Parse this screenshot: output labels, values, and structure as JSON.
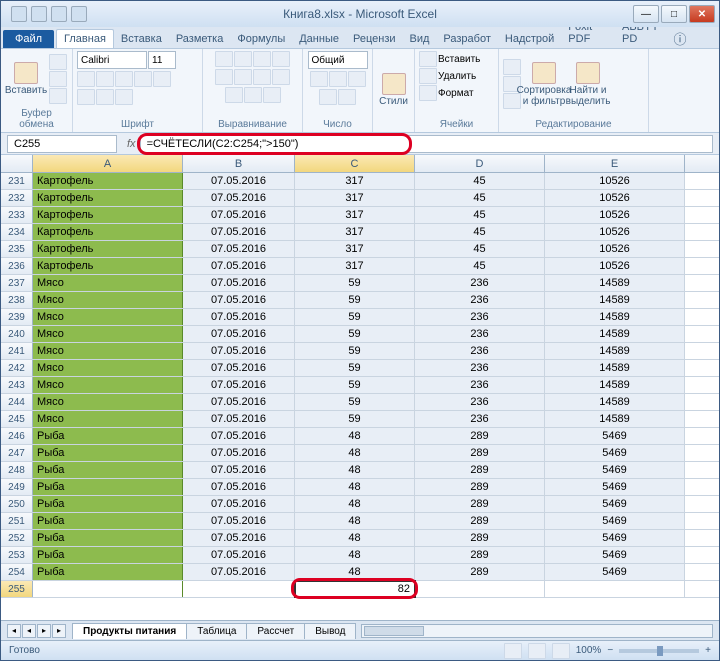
{
  "window": {
    "title": "Книга8.xlsx - Microsoft Excel"
  },
  "ribbon_tabs": {
    "file": "Файл",
    "home": "Главная",
    "insert": "Вставка",
    "layout": "Разметка",
    "formulas": "Формулы",
    "data": "Данные",
    "review": "Рецензи",
    "view": "Вид",
    "developer": "Разработ",
    "addins": "Надстрой",
    "foxit": "Foxit PDF",
    "abbyy": "ABBYY PD"
  },
  "ribbon": {
    "paste": "Вставить",
    "clipboard_label": "Буфер обмена",
    "font_name": "Calibri",
    "font_size": "11",
    "font_label": "Шрифт",
    "align_label": "Выравнивание",
    "number_format": "Общий",
    "number_label": "Число",
    "styles": "Стили",
    "insert_cells": "Вставить",
    "delete_cells": "Удалить",
    "format_cells": "Формат",
    "cells_label": "Ячейки",
    "sort_filter": "Сортировка и фильтр",
    "find_select": "Найти и выделить",
    "editing_label": "Редактирование"
  },
  "namebox": "C255",
  "fx_label": "fx",
  "formula": "=СЧЁТЕСЛИ(C2:C254;\">150\")",
  "columns": {
    "a": "A",
    "b": "B",
    "c": "C",
    "d": "D",
    "e": "E"
  },
  "rows": [
    {
      "n": 231,
      "a": "Картофель",
      "b": "07.05.2016",
      "c": "317",
      "d": "45",
      "e": "10526"
    },
    {
      "n": 232,
      "a": "Картофель",
      "b": "07.05.2016",
      "c": "317",
      "d": "45",
      "e": "10526"
    },
    {
      "n": 233,
      "a": "Картофель",
      "b": "07.05.2016",
      "c": "317",
      "d": "45",
      "e": "10526"
    },
    {
      "n": 234,
      "a": "Картофель",
      "b": "07.05.2016",
      "c": "317",
      "d": "45",
      "e": "10526"
    },
    {
      "n": 235,
      "a": "Картофель",
      "b": "07.05.2016",
      "c": "317",
      "d": "45",
      "e": "10526"
    },
    {
      "n": 236,
      "a": "Картофель",
      "b": "07.05.2016",
      "c": "317",
      "d": "45",
      "e": "10526"
    },
    {
      "n": 237,
      "a": "Мясо",
      "b": "07.05.2016",
      "c": "59",
      "d": "236",
      "e": "14589"
    },
    {
      "n": 238,
      "a": "Мясо",
      "b": "07.05.2016",
      "c": "59",
      "d": "236",
      "e": "14589"
    },
    {
      "n": 239,
      "a": "Мясо",
      "b": "07.05.2016",
      "c": "59",
      "d": "236",
      "e": "14589"
    },
    {
      "n": 240,
      "a": "Мясо",
      "b": "07.05.2016",
      "c": "59",
      "d": "236",
      "e": "14589"
    },
    {
      "n": 241,
      "a": "Мясо",
      "b": "07.05.2016",
      "c": "59",
      "d": "236",
      "e": "14589"
    },
    {
      "n": 242,
      "a": "Мясо",
      "b": "07.05.2016",
      "c": "59",
      "d": "236",
      "e": "14589"
    },
    {
      "n": 243,
      "a": "Мясо",
      "b": "07.05.2016",
      "c": "59",
      "d": "236",
      "e": "14589"
    },
    {
      "n": 244,
      "a": "Мясо",
      "b": "07.05.2016",
      "c": "59",
      "d": "236",
      "e": "14589"
    },
    {
      "n": 245,
      "a": "Мясо",
      "b": "07.05.2016",
      "c": "59",
      "d": "236",
      "e": "14589"
    },
    {
      "n": 246,
      "a": "Рыба",
      "b": "07.05.2016",
      "c": "48",
      "d": "289",
      "e": "5469"
    },
    {
      "n": 247,
      "a": "Рыба",
      "b": "07.05.2016",
      "c": "48",
      "d": "289",
      "e": "5469"
    },
    {
      "n": 248,
      "a": "Рыба",
      "b": "07.05.2016",
      "c": "48",
      "d": "289",
      "e": "5469"
    },
    {
      "n": 249,
      "a": "Рыба",
      "b": "07.05.2016",
      "c": "48",
      "d": "289",
      "e": "5469"
    },
    {
      "n": 250,
      "a": "Рыба",
      "b": "07.05.2016",
      "c": "48",
      "d": "289",
      "e": "5469"
    },
    {
      "n": 251,
      "a": "Рыба",
      "b": "07.05.2016",
      "c": "48",
      "d": "289",
      "e": "5469"
    },
    {
      "n": 252,
      "a": "Рыба",
      "b": "07.05.2016",
      "c": "48",
      "d": "289",
      "e": "5469"
    },
    {
      "n": 253,
      "a": "Рыба",
      "b": "07.05.2016",
      "c": "48",
      "d": "289",
      "e": "5469"
    },
    {
      "n": 254,
      "a": "Рыба",
      "b": "07.05.2016",
      "c": "48",
      "d": "289",
      "e": "5469"
    }
  ],
  "result_row": {
    "n": 255,
    "c": "82"
  },
  "sheet_tabs": {
    "s1": "Продукты питания",
    "s2": "Таблица",
    "s3": "Рассчет",
    "s4": "Вывод"
  },
  "status": {
    "ready": "Готово",
    "zoom": "100%"
  }
}
